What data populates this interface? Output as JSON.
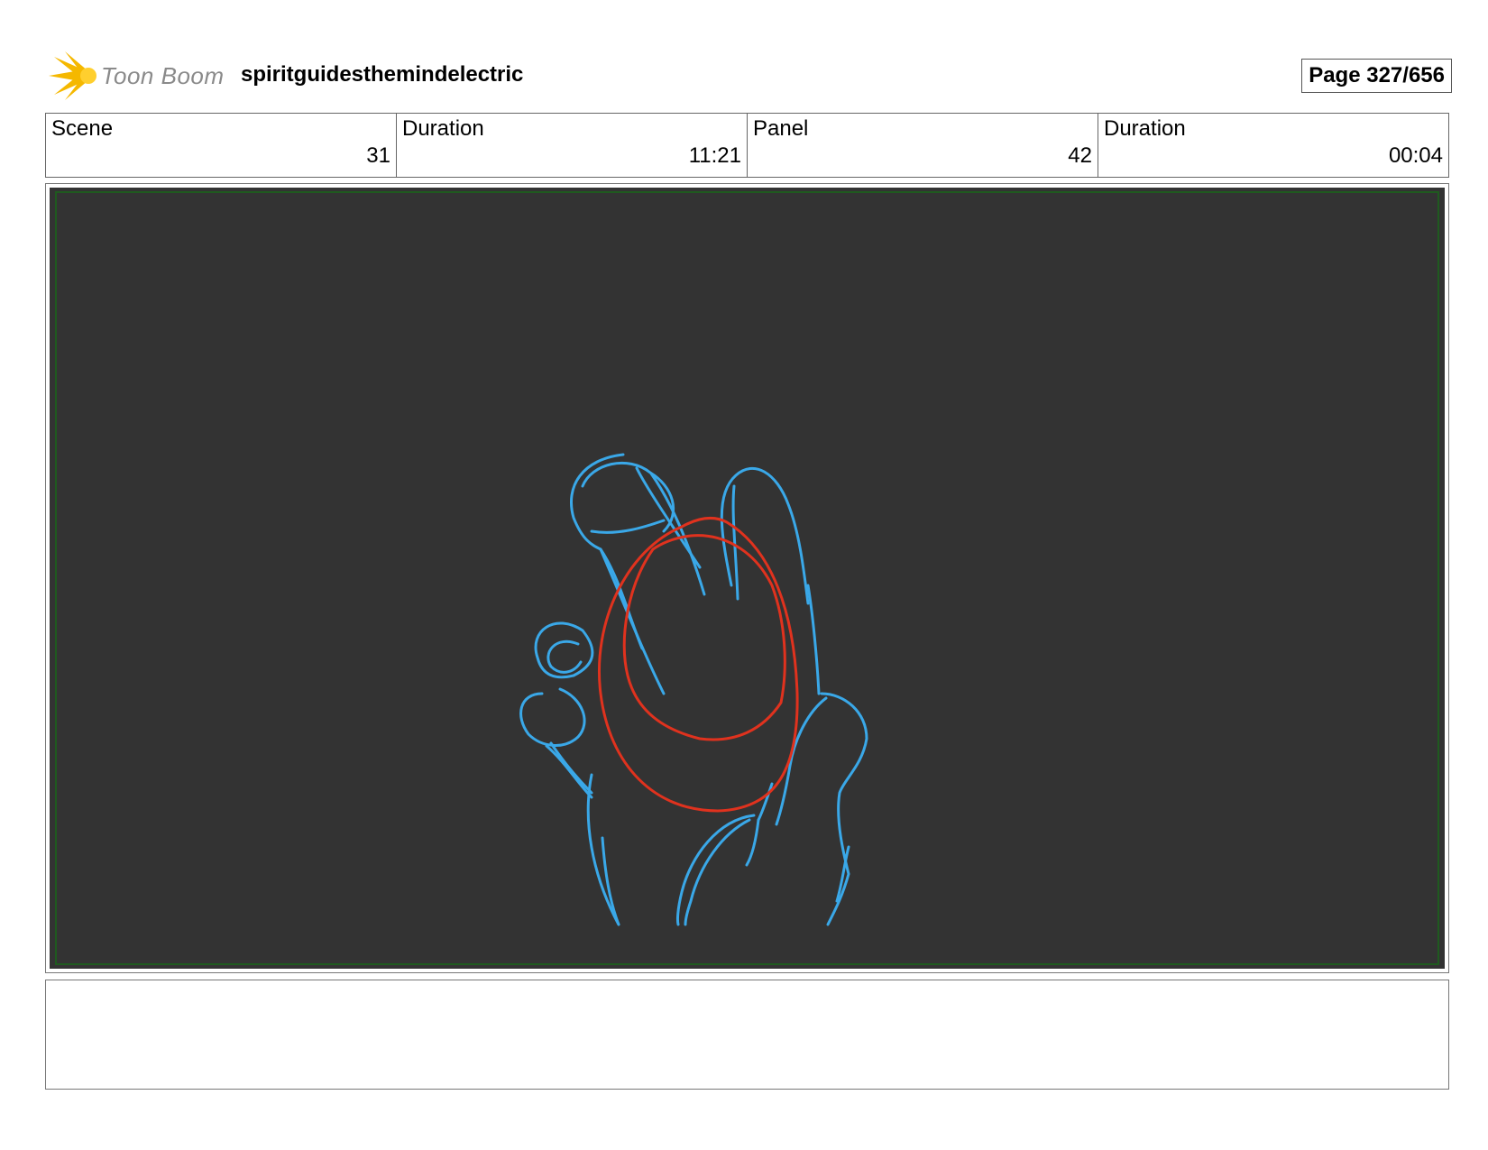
{
  "header": {
    "logo_text": "Toon Boom",
    "project_title": "spiritguidesthemindelectric",
    "page": "Page 327/656"
  },
  "info": {
    "scene_label": "Scene",
    "scene_value": "31",
    "scene_duration_label": "Duration",
    "scene_duration_value": "11:21",
    "panel_label": "Panel",
    "panel_value": "42",
    "panel_duration_label": "Duration",
    "panel_duration_value": "00:04"
  },
  "panel": {
    "background_color": "#333333",
    "sketch_colors": {
      "hand": "#3aa8e8",
      "ball": "#e0321e"
    }
  },
  "notes": {
    "text": ""
  }
}
